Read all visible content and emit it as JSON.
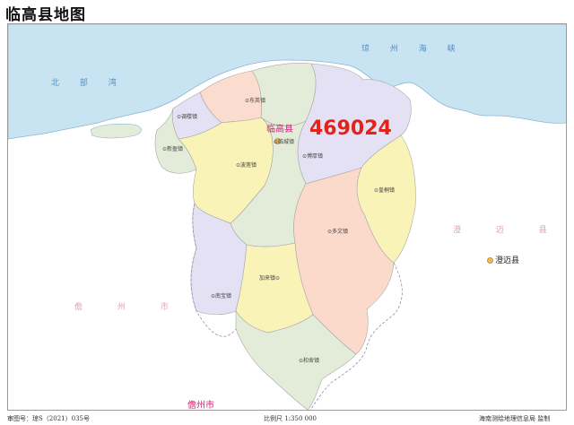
{
  "title": "临高县地图",
  "code_label": "469024",
  "seas": {
    "qiongzhou_strait": "琼 州 海 峡",
    "beibu_gulf": "北 部 湾"
  },
  "neighbors": {
    "chengmai": "澄 迈 县",
    "danzhou_region": "儋 州 市",
    "danzhou_city": "儋州市",
    "chengmai_seat": "澄迈县"
  },
  "county_seat": "临高县",
  "towns": {
    "dongying": "⊙东英镇",
    "tiaolou": "⊙调楼镇",
    "xinying": "⊙新盈镇",
    "lincheng": "⊙临城镇",
    "bohou": "⊙博厚镇",
    "bolian": "⊙波莲镇",
    "huangtong": "⊙皇桐镇",
    "duowen": "⊙多文镇",
    "jialai": "加来镇⊙",
    "nanbao": "⊙南宝镇",
    "hesheng": "⊙和舍镇"
  },
  "footer": {
    "map_no": "审图号：琼S（2021）035号",
    "scale": "比例尺 1:350 000",
    "publisher": "海南测绘地理信息局 监制"
  },
  "colors": {
    "sea": "#c8e4f3",
    "land": "#ffffff",
    "coast": "#8ab6d2",
    "region_pink": "#fbdccf",
    "region_lavender": "#e3e1f3",
    "region_green": "#e3ecd8",
    "region_yellow": "#f9f3b7",
    "region_salmon": "#fbdacb",
    "code_red": "#e3231b",
    "seat_magenta": "#d4237a"
  }
}
